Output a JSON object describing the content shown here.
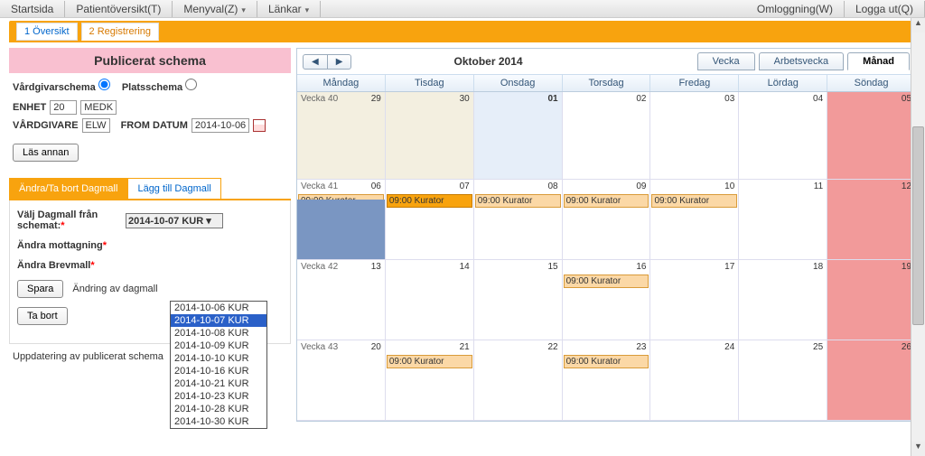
{
  "menu": {
    "start": "Startsida",
    "patient": "Patientöversikt(T)",
    "menyval": "Menyval(Z)",
    "lankar": "Länkar",
    "omlogg": "Omloggning(W)",
    "logout": "Logga ut(Q)"
  },
  "tabs": {
    "t1": "1 Översikt",
    "t2": "2 Registrering"
  },
  "left": {
    "title": "Publicerat schema",
    "radio1": "Vårdgivarschema",
    "radio2": "Platsschema",
    "enhet_lbl": "ENHET",
    "enhet_val": "20",
    "enhet_code": "MEDK",
    "vard_lbl": "VÅRDGIVARE",
    "vard_val": "ELW",
    "from_lbl": "FROM DATUM",
    "from_val": "2014-10-06",
    "las_annan": "Läs annan",
    "otab1": "Ändra/Ta bort Dagmall",
    "otab2": "Lägg till Dagmall",
    "valj_lbl": "Välj Dagmall från schemat:",
    "valj_val": "2014-10-07 KUR",
    "andra_mott": "Ändra mottagning",
    "andra_brev": "Ändra Brevmall",
    "spara": "Spara",
    "andring_txt": "Ändring av dagmall",
    "tabort": "Ta bort",
    "upd_txt": "Uppdatering av publicerat schema",
    "opts": [
      "2014-10-06 KUR",
      "2014-10-07 KUR",
      "2014-10-08 KUR",
      "2014-10-09 KUR",
      "2014-10-10 KUR",
      "2014-10-16 KUR",
      "2014-10-21 KUR",
      "2014-10-23 KUR",
      "2014-10-28 KUR",
      "2014-10-30 KUR"
    ]
  },
  "cal": {
    "title": "Oktober 2014",
    "views": {
      "vecka": "Vecka",
      "arbets": "Arbetsvecka",
      "manad": "Månad"
    },
    "days": [
      "Måndag",
      "Tisdag",
      "Onsdag",
      "Torsdag",
      "Fredag",
      "Lördag",
      "Söndag"
    ],
    "event_label": "09:00 Kurator",
    "weeks": [
      "Vecka 40",
      "Vecka 41",
      "Vecka 42",
      "Vecka 43"
    ],
    "grid": {
      "w0": [
        "29",
        "30",
        "01",
        "02",
        "03",
        "04",
        "05"
      ],
      "w1": [
        "06",
        "07",
        "08",
        "09",
        "10",
        "11",
        "12"
      ],
      "w2": [
        "13",
        "14",
        "15",
        "16",
        "17",
        "18",
        "19"
      ],
      "w3": [
        "20",
        "21",
        "22",
        "23",
        "24",
        "25",
        "26"
      ]
    }
  }
}
